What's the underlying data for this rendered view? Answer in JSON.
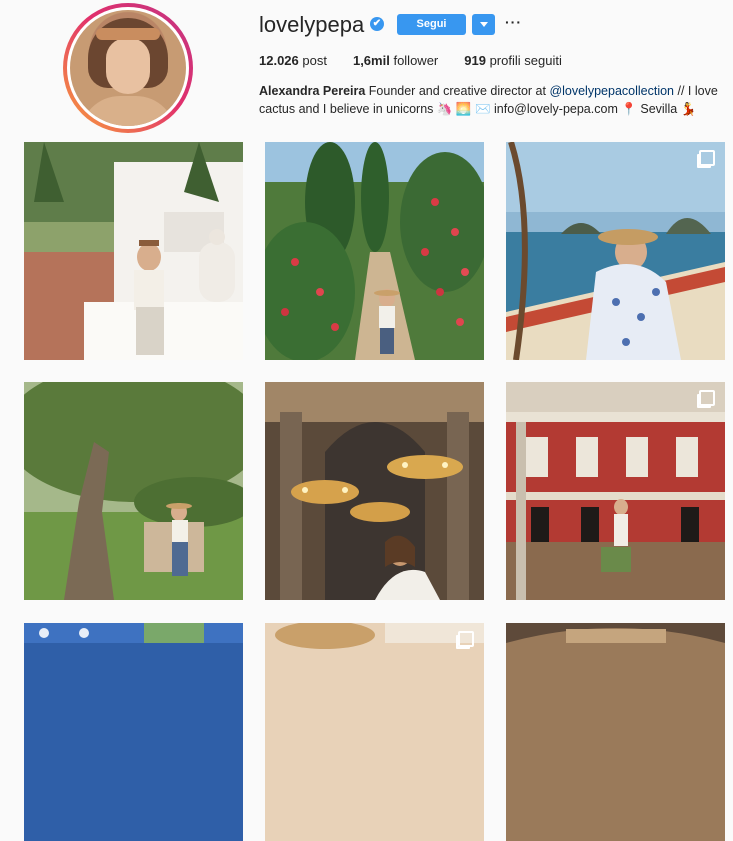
{
  "profile": {
    "username": "lovelypepa",
    "verified_glyph": "✔",
    "follow_label": "Segui",
    "more_label": "···",
    "stats": {
      "posts_value": "12.026",
      "posts_label": "post",
      "followers_value": "1,6mil",
      "followers_label": "follower",
      "following_value": "919",
      "following_label": "profili seguiti"
    },
    "bio": {
      "name": "Alexandra Pereira",
      "text_before_link": " Founder and creative director at ",
      "link": "@lovelypepacollection",
      "text_after_link": " // I love cactus and I believe in unicorns 🦄 🌅 ✉️ info@lovely-pepa.com 📍 Sevilla 💃"
    }
  },
  "colors": {
    "accent": "#3897f0",
    "link": "#003569",
    "background": "#fafafa",
    "text": "#262626"
  },
  "posts": [
    {
      "name": "post-white-terrace",
      "multiple": false
    },
    {
      "name": "post-flower-garden-path",
      "multiple": false
    },
    {
      "name": "post-boat-sea",
      "multiple": true
    },
    {
      "name": "post-olive-tree-garden",
      "multiple": false
    },
    {
      "name": "post-hagia-sophia-chandeliers",
      "multiple": false
    },
    {
      "name": "post-red-courtyard",
      "multiple": true
    },
    {
      "name": "post-blue-tiles",
      "multiple": false
    },
    {
      "name": "post-partial-2",
      "multiple": true
    },
    {
      "name": "post-partial-3",
      "multiple": false
    }
  ]
}
